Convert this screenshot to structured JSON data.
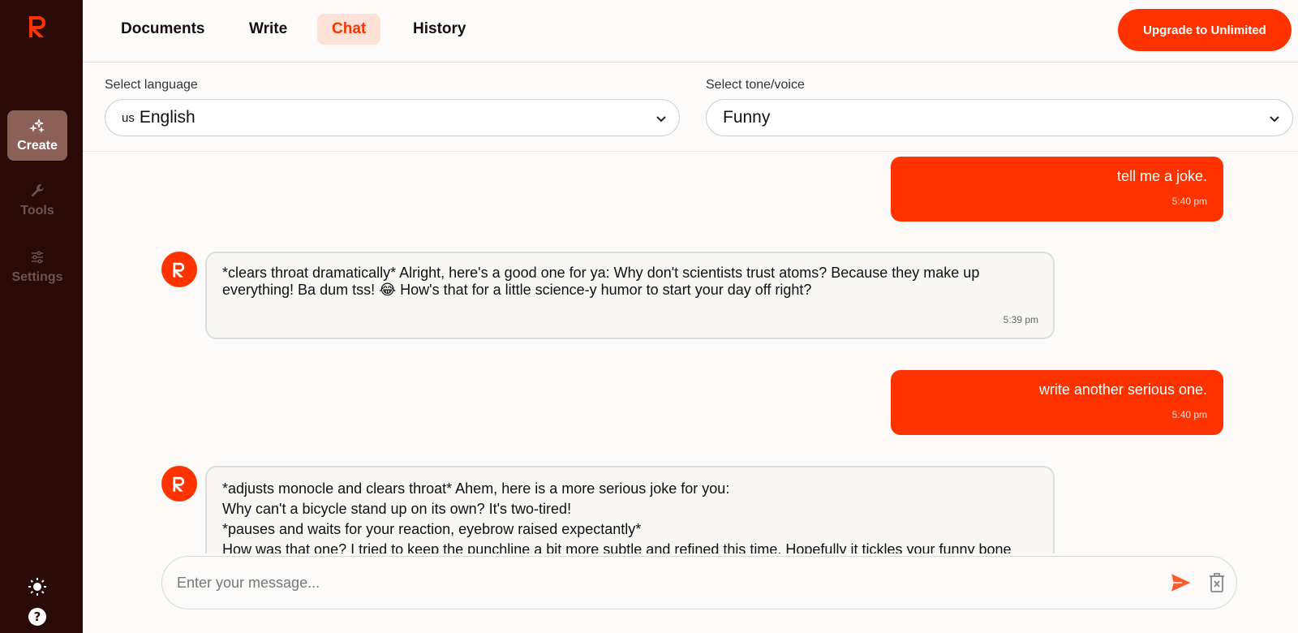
{
  "app": {
    "brand_color": "#ff3300"
  },
  "sidebar": {
    "items": [
      {
        "label": "Create",
        "icon": "sparkles-icon",
        "active": true
      },
      {
        "label": "Tools",
        "icon": "wrench-icon",
        "active": false
      },
      {
        "label": "Settings",
        "icon": "sliders-icon",
        "active": false
      }
    ],
    "bottom_icons": [
      "sun-icon",
      "help-icon"
    ]
  },
  "nav": {
    "tabs": [
      {
        "label": "Documents",
        "active": false
      },
      {
        "label": "Write",
        "active": false
      },
      {
        "label": "Chat",
        "active": true
      },
      {
        "label": "History",
        "active": false
      }
    ],
    "upgrade_label": "Upgrade to Unlimited"
  },
  "selectors": {
    "language": {
      "label": "Select language",
      "prefix": "us",
      "value": "English"
    },
    "tone": {
      "label": "Select tone/voice",
      "value": "Funny"
    }
  },
  "messages": [
    {
      "role": "user",
      "text": "tell me a joke.",
      "time": "5:40 pm"
    },
    {
      "role": "bot",
      "lines": [
        "*clears throat dramatically* Alright, here's a good one for ya: Why don't scientists trust atoms? Because they make up everything! Ba dum tss! 😂 How's that for a little science-y humor to start your day off right?"
      ],
      "time": "5:39 pm"
    },
    {
      "role": "user",
      "text": "write another serious one.",
      "time": "5:40 pm"
    },
    {
      "role": "bot",
      "lines": [
        "*adjusts monocle and clears throat* Ahem, here is a more serious joke for you:",
        "Why can't a bicycle stand up on its own? It's two-tired!",
        "*pauses and waits for your reaction, eyebrow raised expectantly*",
        "How was that one? I tried to keep the punchline a bit more subtle and refined this time. Hopefully it tickles your funny bone"
      ],
      "time": ""
    }
  ],
  "composer": {
    "placeholder": "Enter your message..."
  }
}
